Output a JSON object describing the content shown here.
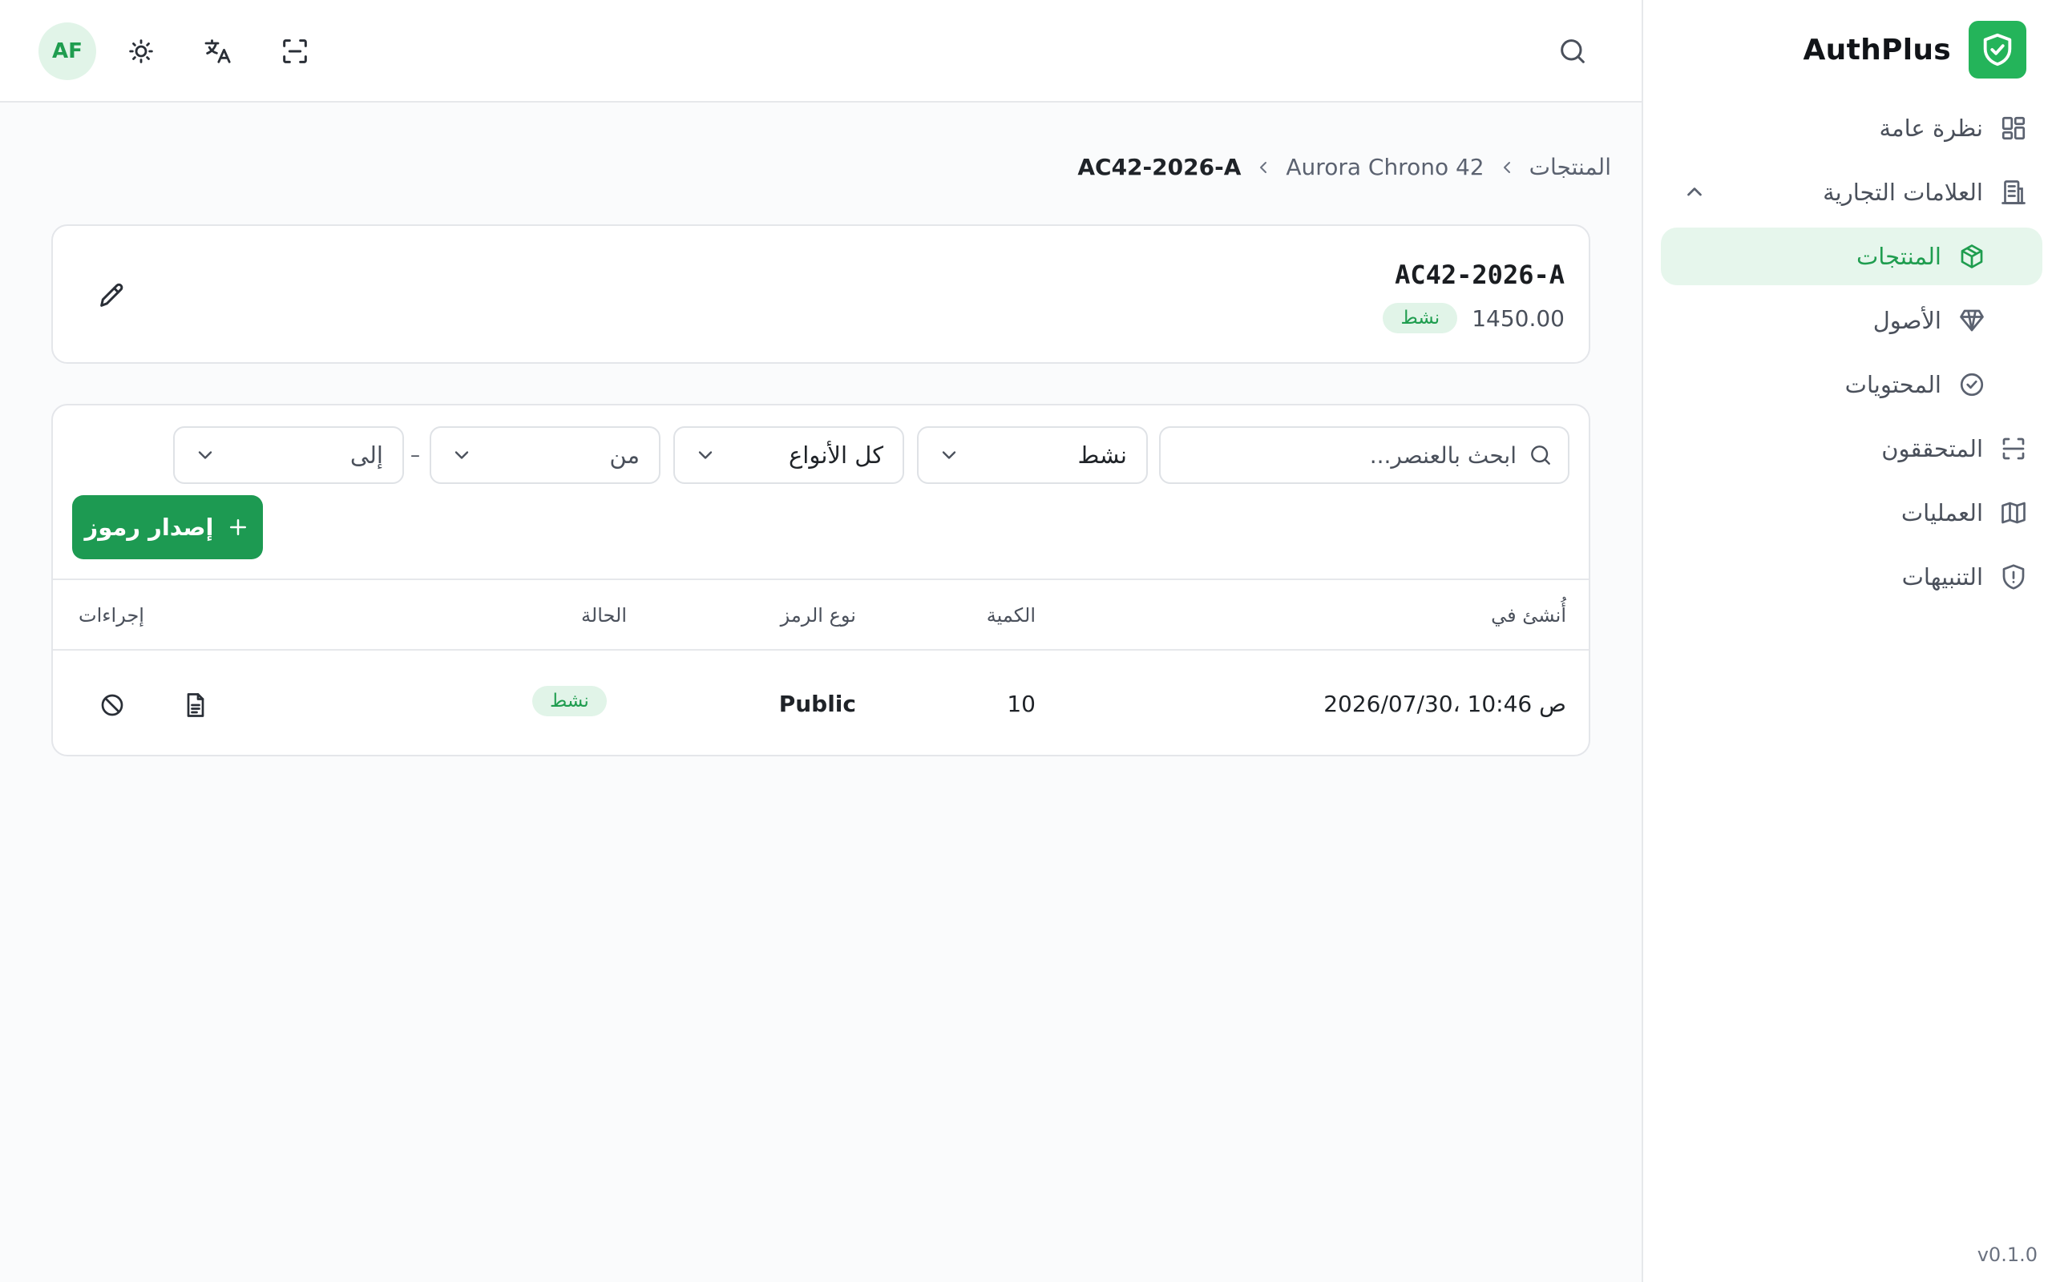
{
  "brand": {
    "name": "AuthPlus",
    "version": "v0.1.0"
  },
  "sidebar": {
    "items": [
      {
        "label": "نظرة عامة",
        "icon": "grid-icon"
      },
      {
        "label": "العلامات التجارية",
        "icon": "building-icon",
        "expanded": true
      },
      {
        "label": "المنتجات",
        "icon": "box-icon",
        "active": true
      },
      {
        "label": "الأصول",
        "icon": "gem-icon"
      },
      {
        "label": "المحتويات",
        "icon": "check-circle-icon"
      },
      {
        "label": "المتحققون",
        "icon": "scan-icon"
      },
      {
        "label": "العمليات",
        "icon": "map-icon"
      },
      {
        "label": "التنبيهات",
        "icon": "shield-alert-icon"
      }
    ]
  },
  "topbar": {
    "avatar_initials": "AF"
  },
  "breadcrumb": {
    "root": "المنتجات",
    "product": "Aurora Chrono 42",
    "current": "AC42-2026-A"
  },
  "product": {
    "sku": "AC42-2026-A",
    "price": "1450.00",
    "status": "نشط"
  },
  "filters": {
    "search_placeholder": "ابحث بالعنصر...",
    "status_value": "نشط",
    "type_value": "كل الأنواع",
    "from_placeholder": "من",
    "to_placeholder": "إلى",
    "range_separator": "–"
  },
  "actions": {
    "issue_label": "إصدار رموز"
  },
  "table": {
    "headers": {
      "created": "أُنشئ في",
      "quantity": "الكمية",
      "type": "نوع الرمز",
      "status": "الحالة",
      "actions": "إجراءات"
    },
    "rows": [
      {
        "created": "2026/07/30، 10:46 ص",
        "quantity": "10",
        "type": "Public",
        "status": "نشط"
      }
    ]
  },
  "colors": {
    "accent": "#1d9a52",
    "accent_soft": "#e1f4e8",
    "border": "#e4e6ea"
  }
}
